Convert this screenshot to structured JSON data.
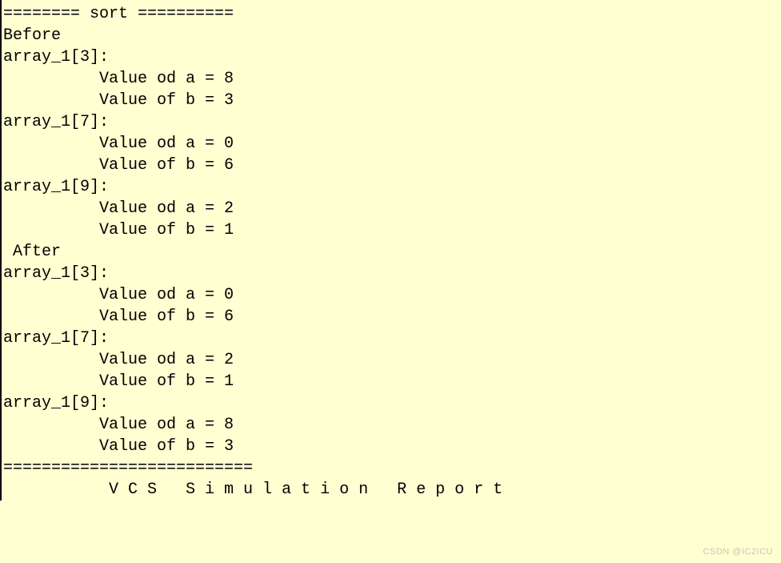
{
  "lines": {
    "l0": "======== sort ==========",
    "l1": "Before",
    "l2": "array_1[3]:",
    "l3": "          Value od a = 8",
    "l4": "          Value of b = 3",
    "l5": "array_1[7]:",
    "l6": "          Value od a = 0",
    "l7": "          Value of b = 6",
    "l8": "array_1[9]:",
    "l9": "          Value od a = 2",
    "l10": "          Value of b = 1",
    "l11": "",
    "l12": " After",
    "l13": "array_1[3]:",
    "l14": "          Value od a = 0",
    "l15": "          Value of b = 6",
    "l16": "array_1[7]:",
    "l17": "          Value od a = 2",
    "l18": "          Value of b = 1",
    "l19": "array_1[9]:",
    "l20": "          Value od a = 8",
    "l21": "          Value of b = 3",
    "l22": "==========================",
    "l23": "           V C S   S i m u l a t i o n   R e p o r t"
  },
  "watermark": "CSDN @IC2ICU"
}
